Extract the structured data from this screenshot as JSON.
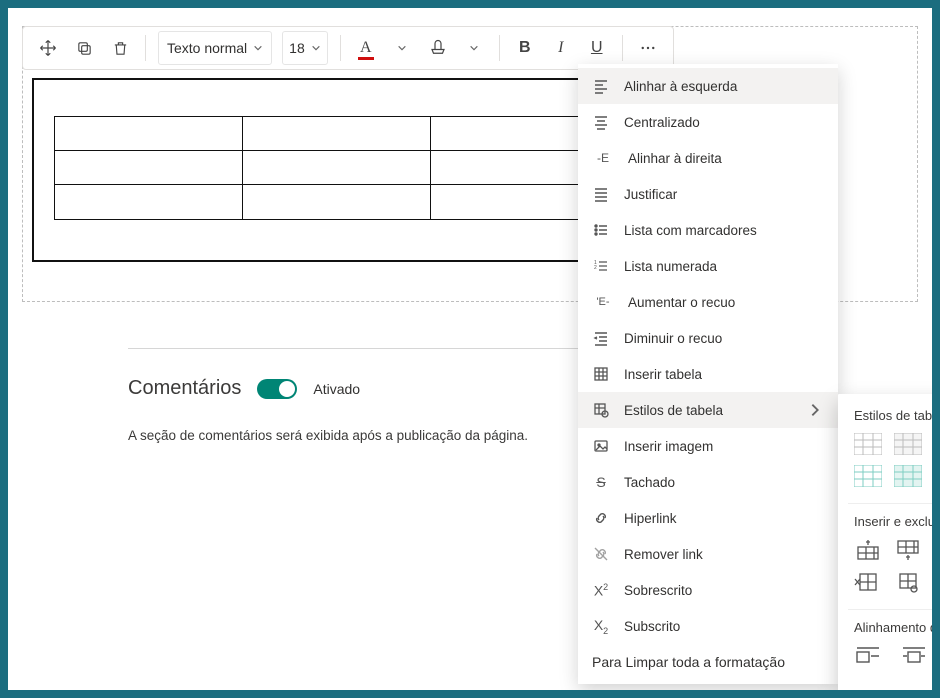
{
  "toolbar": {
    "text_style": "Texto normal",
    "font_size": "18"
  },
  "comments": {
    "title": "Comentários",
    "toggle_label": "Ativado",
    "description": "A seção de comentários será exibida após a publicação da página."
  },
  "menu": {
    "items": [
      {
        "label": "Alinhar à esquerda",
        "icon": "align-left"
      },
      {
        "label": "Centralizado",
        "icon": "align-center"
      },
      {
        "label": "Alinhar à direita",
        "icon": "align-right",
        "prefix": "-E "
      },
      {
        "label": "Justificar",
        "icon": "align-justify"
      },
      {
        "label": "Lista com marcadores",
        "icon": "bullet-list"
      },
      {
        "label": "Lista numerada",
        "icon": "numbered-list"
      },
      {
        "label": "Aumentar o recuo",
        "icon": "indent-increase",
        "prefix": "'E- "
      },
      {
        "label": "Diminuir o recuo",
        "icon": "indent-decrease"
      },
      {
        "label": "Inserir tabela",
        "icon": "table"
      },
      {
        "label": "Estilos de tabela",
        "icon": "table-styles",
        "submenu": true
      },
      {
        "label": "Inserir imagem",
        "icon": "image"
      },
      {
        "label": "Tachado",
        "icon": "strike"
      },
      {
        "label": "Hiperlink",
        "icon": "link"
      },
      {
        "label": "Remover link",
        "icon": "unlink"
      },
      {
        "label": "Sobrescrito",
        "icon": "superscript"
      },
      {
        "label": "Subscrito",
        "icon": "subscript"
      }
    ],
    "clear": "Para Limpar toda a formatação"
  },
  "submenu": {
    "styles_title": "Estilos de tabela",
    "insert_delete_title": "Inserir e excluir",
    "alignment_title": "Alinhamento de tabela"
  },
  "colors": {
    "teal": "#008575",
    "light_teal": "#7fcec3"
  }
}
